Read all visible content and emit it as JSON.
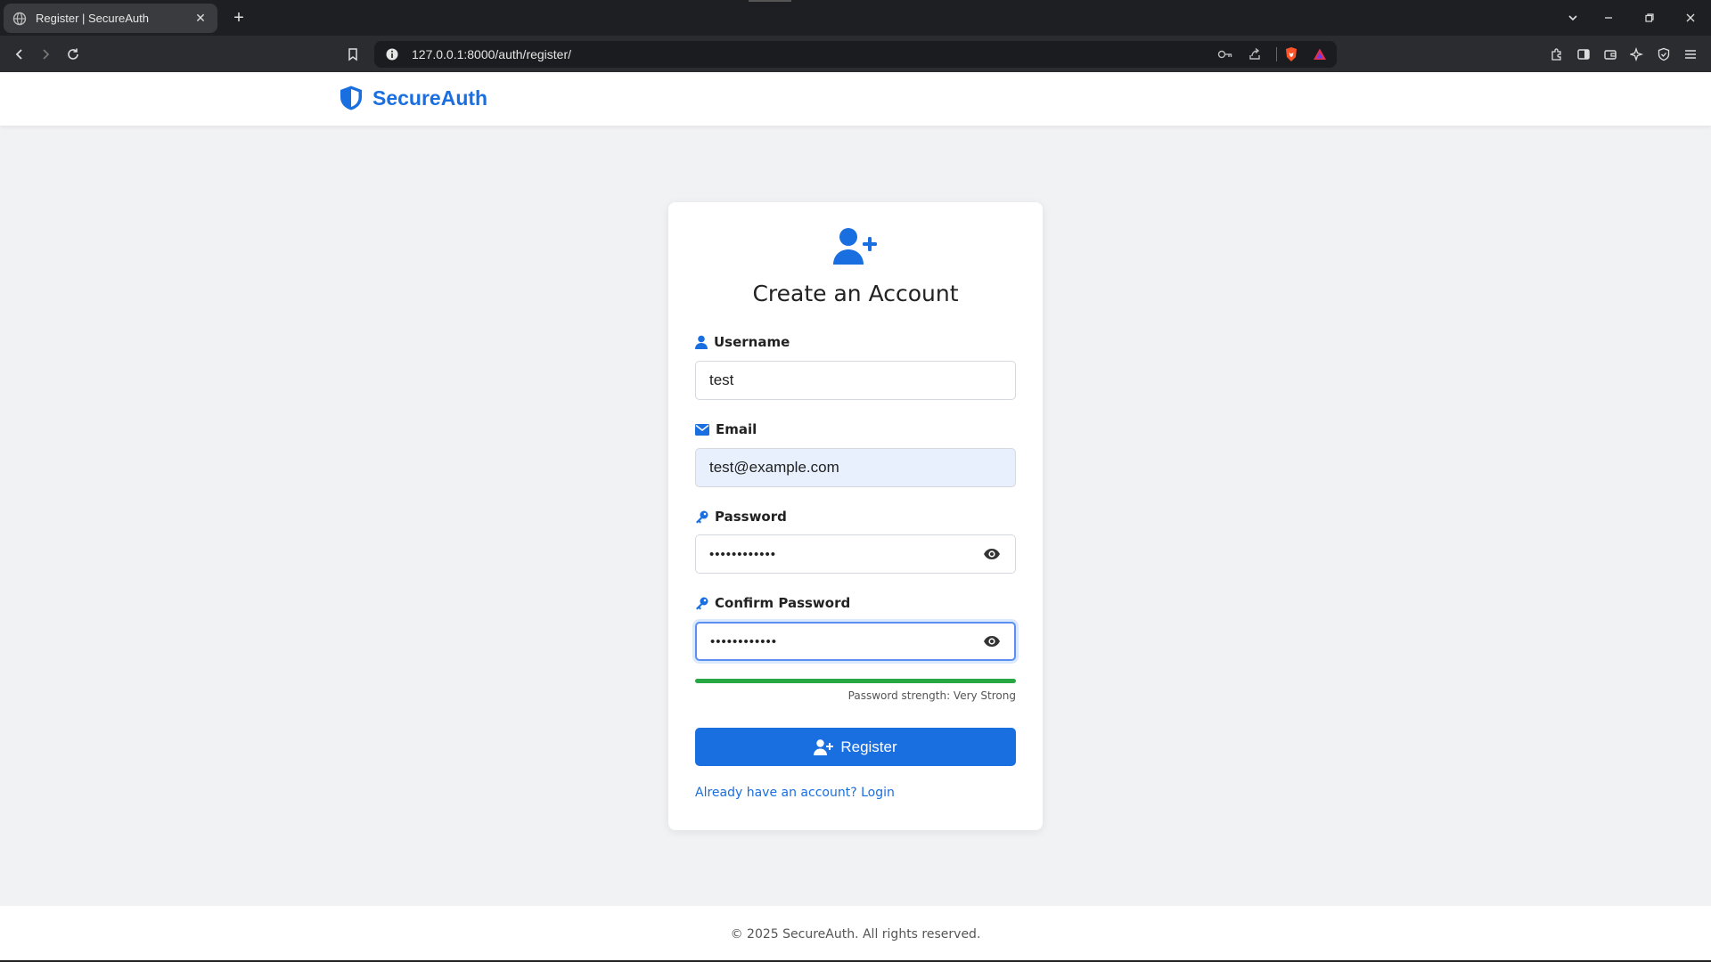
{
  "browser": {
    "tab_title": "Register | SecureAuth",
    "tab_close": "✕",
    "new_tab": "+",
    "url": "127.0.0.1:8000/auth/register/"
  },
  "brand": {
    "name": "SecureAuth",
    "color": "#1a6fe0"
  },
  "form": {
    "title": "Create an Account",
    "username": {
      "label": "Username",
      "value": "test"
    },
    "email": {
      "label": "Email",
      "value": "test@example.com"
    },
    "password": {
      "label": "Password",
      "value": "••••••••••••"
    },
    "confirm_password": {
      "label": "Confirm Password",
      "value": "••••••••••••"
    },
    "strength": {
      "text": "Password strength: Very Strong",
      "fraction": 1.0,
      "color": "#28a745"
    },
    "submit_label": "Register",
    "login_link": "Already have an account? Login"
  },
  "footer": {
    "text": "© 2025 SecureAuth. All rights reserved."
  }
}
